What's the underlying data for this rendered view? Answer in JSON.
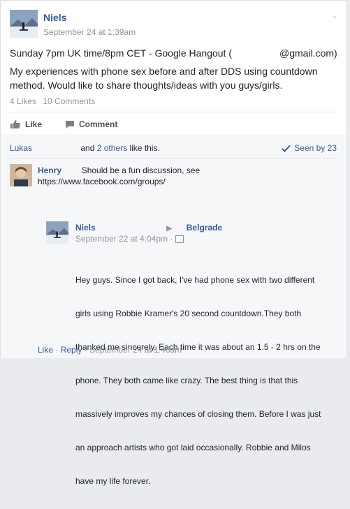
{
  "post": {
    "author": "Niels",
    "timestamp": "September 24 at 1:39am",
    "line1_prefix": "Sunday 7pm UK time/8pm CET - Google Hangout (",
    "line1_suffix": "@gmail.com)",
    "line2": "My experiences with phone sex before and after DDS using countdown",
    "line3": "method. Would like to share thoughts/ideas with you guys/girls.",
    "likes_count": "4 Likes",
    "comments_count": "10 Comments"
  },
  "actions": {
    "like_label": "Like",
    "comment_label": "Comment"
  },
  "likes_summary": {
    "first": "Lukas",
    "middle": "and",
    "others": "2 others",
    "suffix": "like this.",
    "seen": "Seen by 23"
  },
  "comment1": {
    "author": "Henry",
    "text": "Should be a fun discussion, see",
    "link": "https://www.facebook.com/groups/"
  },
  "reply": {
    "author": "Niels",
    "location": "Belgrade",
    "timestamp": "September 22 at 4:04pm",
    "lines": [
      "Hey guys. Since I got back, I've had phone sex with two different",
      "girls using Robbie Kramer's 20 second countdown.They both",
      "thanked me sincerely. Each time it was about an 1.5 - 2 hrs on the",
      "phone. They both came like crazy. The best thing is that this",
      "massively improves my chances of closing them. Before I was just",
      "an approach artists who got laid occasionally. Robbie and Milos",
      "have my life forever."
    ]
  },
  "footer": {
    "like": "Like",
    "dot": "·",
    "reply": "Reply",
    "timestamp": "September 24 at 1:46am"
  }
}
